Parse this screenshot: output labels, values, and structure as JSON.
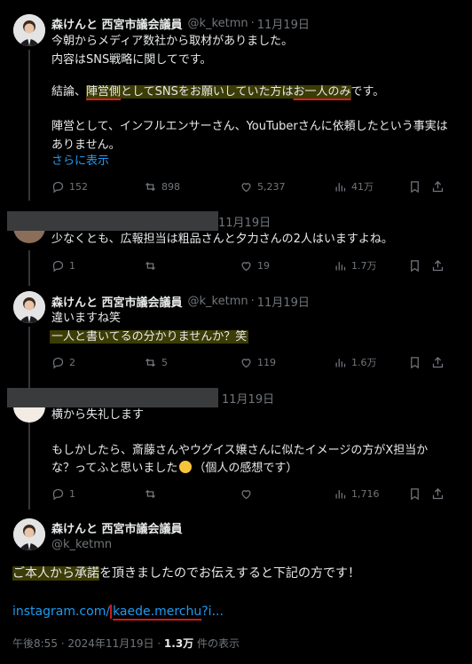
{
  "tweet1": {
    "name": "森けんと 西宮市議会議員",
    "handle": "@k_ketmn",
    "date": "11月19日",
    "line1": "今朝からメディア数社から取材がありました。",
    "line2": "内容はSNS戦略に関してです。",
    "line3_pre": "結論、",
    "line3_a": "陣営側",
    "line3_b": "としてSNSをお願いしていた方は",
    "line3_c": "お一人のみ",
    "line3_post": "です。",
    "line4": "陣営として、インフルエンサーさん、YouTuberさんに依頼したという事実は",
    "line5": "ありません。",
    "show_more": "さらに表示",
    "replies": "152",
    "reposts": "898",
    "likes": "5,237",
    "views": "41万"
  },
  "tweet2": {
    "date": "11月19日",
    "text": "少なくとも、広報担当は粗品さんと夕力さんの2人はいますよね。",
    "replies": "1",
    "reposts": "",
    "likes": "19",
    "views": "1.7万"
  },
  "tweet3": {
    "name": "森けんと 西宮市議会議員",
    "handle": "@k_ketmn",
    "date": "11月19日",
    "line1": "違いますね笑",
    "line2": "一人と書いてるの分かりませんか？笑",
    "replies": "2",
    "reposts": "5",
    "likes": "119",
    "views": "1.6万"
  },
  "tweet4": {
    "date": "11月19日",
    "line1": "横から失礼します",
    "line2": "もしかしたら、斎藤さんやウグイス嬢さんに似たイメージの方がX担当か",
    "line3_pre": "な？ってふと思いました",
    "line3_post": "（個人の感想です）",
    "replies": "1",
    "reposts": "",
    "likes": "",
    "views": "1,716"
  },
  "main": {
    "name": "森けんと 西宮市議会議員",
    "handle": "@k_ketmn",
    "text_hl": "ご本人から承諾",
    "text_rest": "を頂きましたのでお伝えすると下記の方です！",
    "link_pre": "instagram.com/",
    "link_ul": "kaede.merchu",
    "link_post": "?i...",
    "time": "午後8:55 · 2024年11月19日 · ",
    "views_num": "1.3万",
    "views_label": " 件の表示"
  },
  "colors": {
    "background": "#000000",
    "text": "#e7e9ea",
    "muted": "#71767b",
    "link": "#1d9bf0",
    "highlight": "#3c3c06",
    "underline_red": "#e01d1d"
  }
}
